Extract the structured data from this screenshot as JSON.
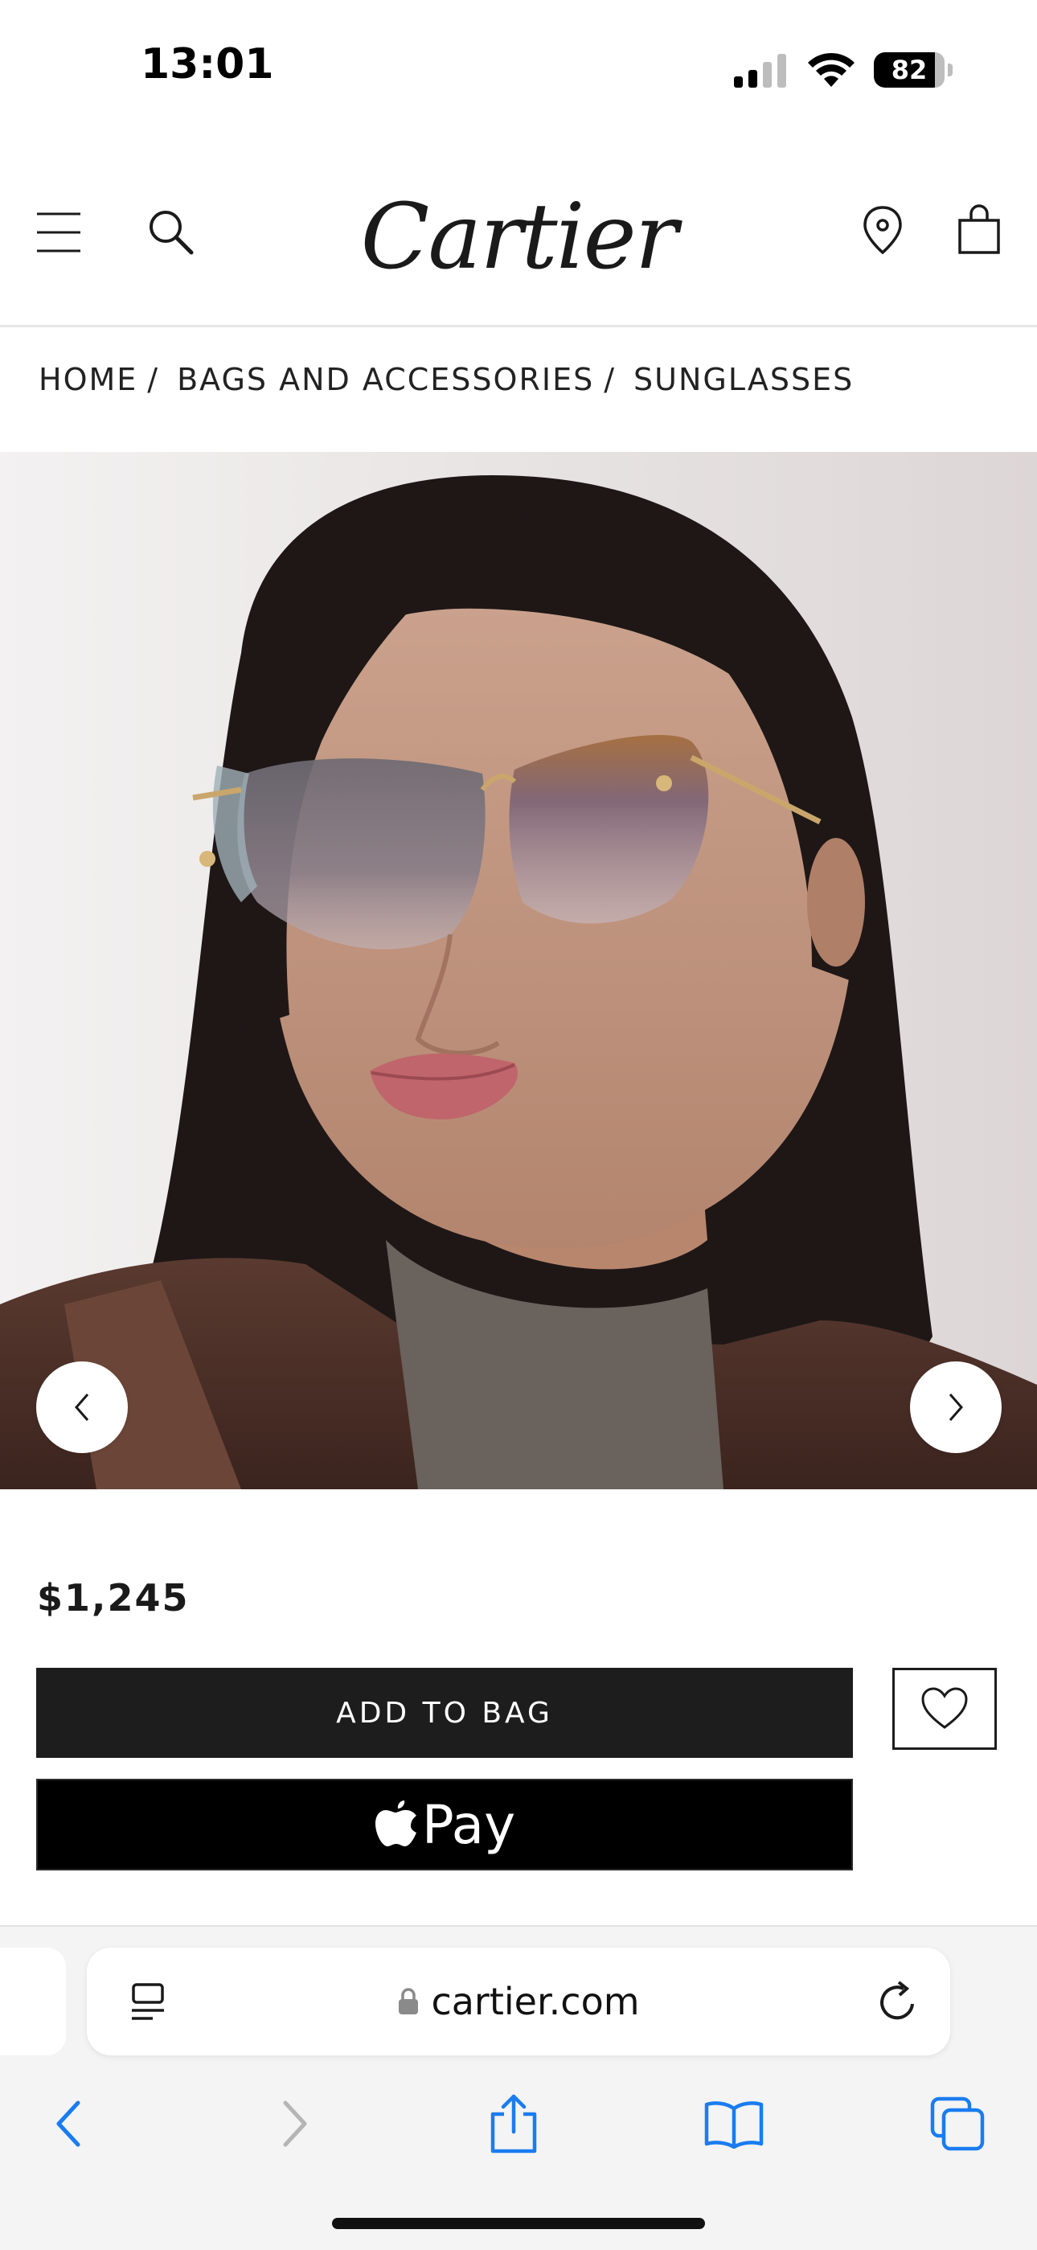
{
  "status_bar": {
    "time": "13:01",
    "battery_level": "82"
  },
  "header": {
    "brand": "Cartier",
    "icons": [
      "menu-icon",
      "search-icon",
      "store-locator-icon",
      "shopping-bag-icon"
    ]
  },
  "breadcrumb": [
    {
      "label": "HOME",
      "sep": "/"
    },
    {
      "label": "BAGS AND ACCESSORIES",
      "sep": "/"
    },
    {
      "label": "SUNGLASSES"
    }
  ],
  "product": {
    "price": "$1,245",
    "add_to_bag_label": "ADD TO BAG",
    "apple_pay_label": "Pay"
  },
  "browser": {
    "url": "cartier.com",
    "toolbar": [
      "back-icon",
      "forward-icon",
      "share-icon",
      "bookmarks-icon",
      "tabs-icon"
    ]
  },
  "colors": {
    "accent": "#1d1d1d",
    "safari_blue": "#1a7cf0",
    "background": "#ffffff"
  }
}
